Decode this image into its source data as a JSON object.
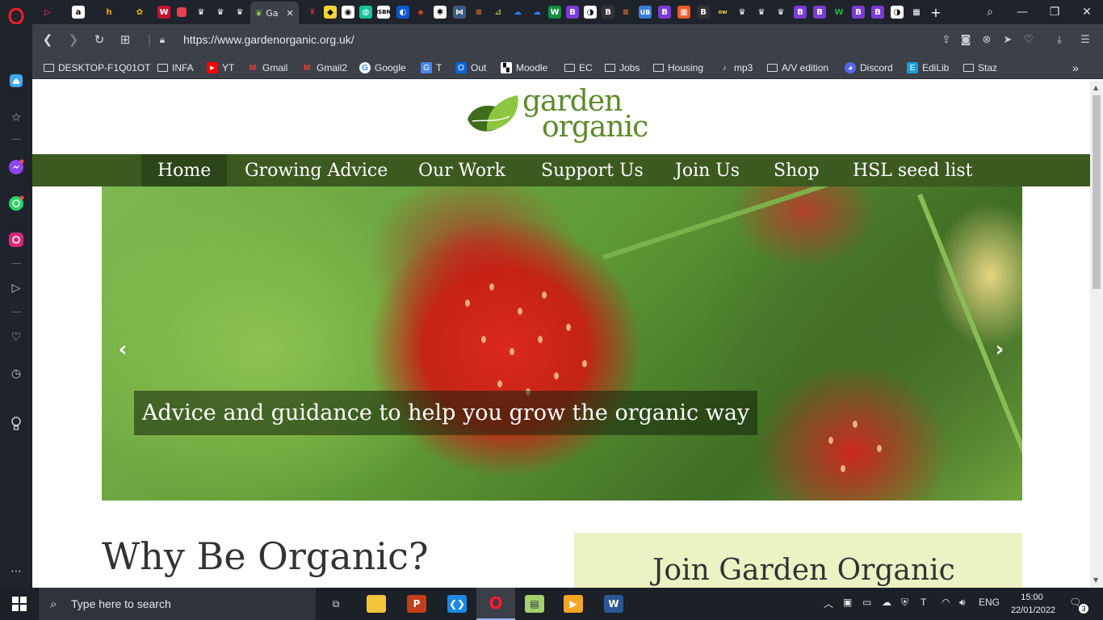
{
  "browser": {
    "active_tab_title": "Ga",
    "url": "https://www.gardenorganic.org.uk/",
    "bookmarks": [
      {
        "label": "DESKTOP-F1Q01OT",
        "icon": "folder-icon"
      },
      {
        "label": "INFA",
        "icon": "folder-icon"
      },
      {
        "label": "YT",
        "icon": "youtube-icon"
      },
      {
        "label": "Gmail",
        "icon": "gmail-icon"
      },
      {
        "label": "Gmail2",
        "icon": "gmail-icon"
      },
      {
        "label": "Google",
        "icon": "google-icon"
      },
      {
        "label": "T",
        "icon": "translate-icon"
      },
      {
        "label": "Out",
        "icon": "outlook-icon"
      },
      {
        "label": "Moodle",
        "icon": "moodle-icon"
      },
      {
        "label": "EC",
        "icon": "folder-icon"
      },
      {
        "label": "Jobs",
        "icon": "folder-icon"
      },
      {
        "label": "Housing",
        "icon": "folder-icon"
      },
      {
        "label": "mp3",
        "icon": "music-icon"
      },
      {
        "label": "A/V edition",
        "icon": "folder-icon"
      },
      {
        "label": "Discord",
        "icon": "discord-icon"
      },
      {
        "label": "EdiLib",
        "icon": "edilib-icon"
      },
      {
        "label": "Staz",
        "icon": "folder-icon"
      }
    ],
    "tab_favicons": [
      "B",
      "B",
      "B",
      "B",
      "B",
      "B",
      "B",
      "B"
    ]
  },
  "site": {
    "logo_line1": "garden",
    "logo_line2": "organic",
    "nav": [
      {
        "label": "Home"
      },
      {
        "label": "Growing Advice"
      },
      {
        "label": "Our Work"
      },
      {
        "label": "Support Us"
      },
      {
        "label": "Join Us"
      },
      {
        "label": "Shop"
      },
      {
        "label": "HSL seed list"
      }
    ],
    "hero_caption": "Advice and guidance to help you grow the organic way",
    "why_title": "Why Be Organic?",
    "join_title": "Join Garden Organic",
    "colors": {
      "nav_bg": "#3c5a20",
      "nav_active": "#2d4619",
      "logo_green": "#5c8a2a",
      "join_bg": "#ecf2c4"
    }
  },
  "taskbar": {
    "search_placeholder": "Type here to search",
    "language": "ENG",
    "time": "15:00",
    "date": "22/01/2022",
    "notifications": "3"
  }
}
